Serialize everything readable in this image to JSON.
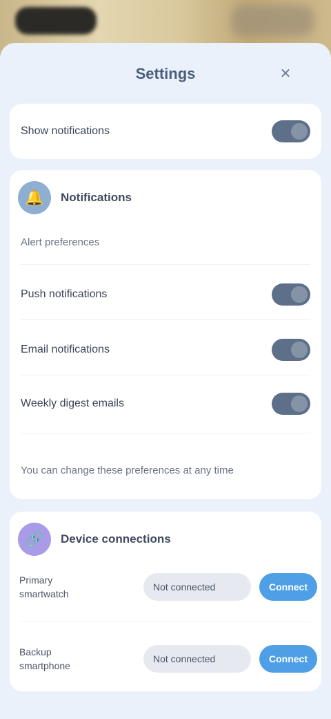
{
  "colors": {
    "sheet_bg": "#eaf1fa",
    "card_bg": "#ffffff",
    "toggle_on": "#5d6f89",
    "accent_blue": "#4e9fe6",
    "section1_icon_bg": "#8eaed2",
    "section2_icon_bg": "#a99be8"
  },
  "header": {
    "title": "Settings",
    "close_icon": "close-icon",
    "close_glyph": "✕"
  },
  "top_card": {
    "label": "Show notifications",
    "toggle_on": true
  },
  "section1": {
    "icon": "bell-icon",
    "icon_glyph": "🔔",
    "title": "Notifications",
    "subtitle": "Alert preferences",
    "rows": [
      {
        "label": "Push notifications",
        "toggle_on": true
      },
      {
        "label": "Email notifications",
        "toggle_on": true
      },
      {
        "label": "Weekly digest emails",
        "toggle_on": true
      }
    ],
    "footer_note": "You can change these preferences at any time"
  },
  "section2": {
    "icon": "link-icon",
    "icon_glyph": "🔗",
    "title": "Device connections",
    "rows": [
      {
        "label_line1": "Primary",
        "label_line2": "smartwatch",
        "input_value": "Not connected",
        "button_label": "Connect"
      },
      {
        "label_line1": "Backup",
        "label_line2": "smartphone",
        "input_value": "Not connected",
        "button_label": "Connect"
      }
    ]
  }
}
